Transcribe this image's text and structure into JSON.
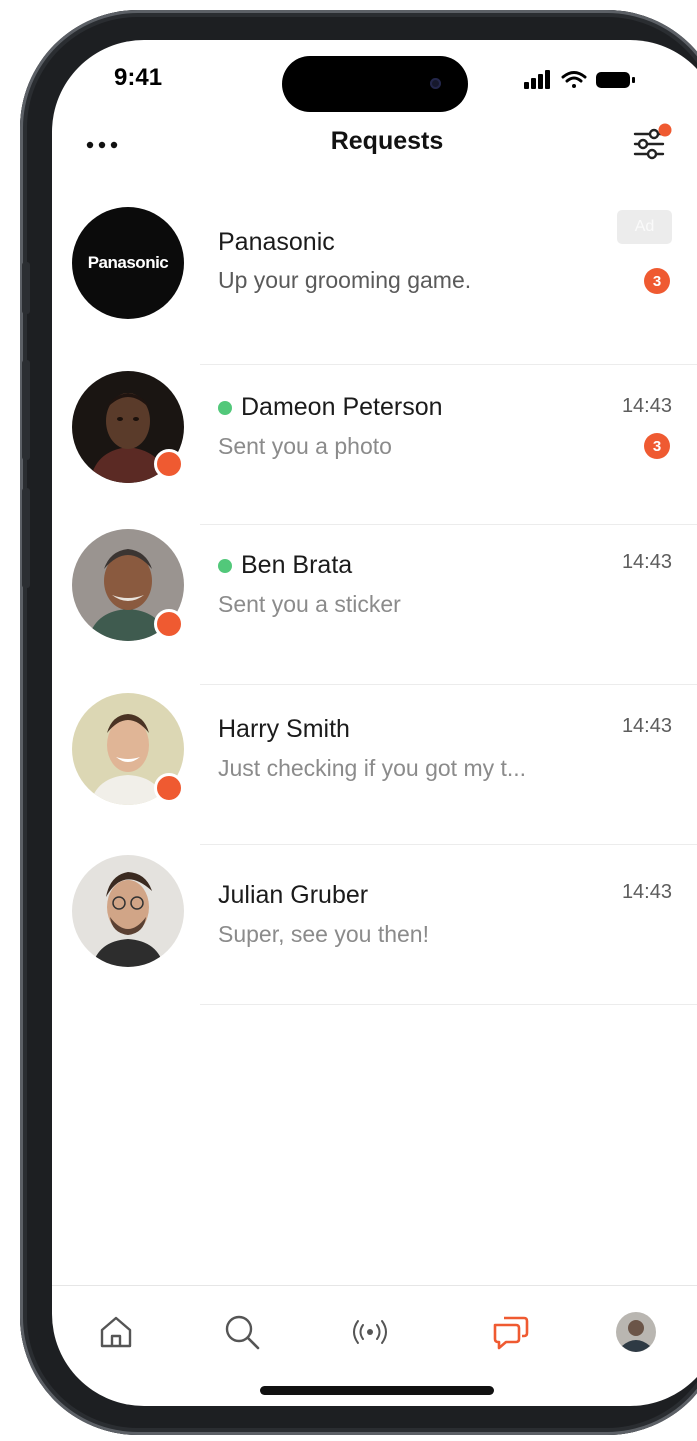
{
  "status_bar": {
    "time": "9:41"
  },
  "header": {
    "title": "Requests",
    "more_icon": "ellipsis-icon",
    "filter_icon": "sliders-icon"
  },
  "conversations": [
    {
      "name": "Panasonic",
      "preview": "Up your grooming game.",
      "ad_label": "Ad",
      "unread": "3",
      "logo_text": "Panasonic"
    },
    {
      "name": "Dameon Peterson",
      "preview": "Sent you a photo",
      "time": "14:43",
      "unread": "3",
      "online": true
    },
    {
      "name": "Ben Brata",
      "preview": "Sent you a sticker",
      "time": "14:43",
      "online": true
    },
    {
      "name": "Harry Smith",
      "preview": "Just checking if you got my t...",
      "time": "14:43"
    },
    {
      "name": "Julian Gruber",
      "preview": "Super, see you then!",
      "time": "14:43"
    }
  ],
  "tab_bar": {
    "items": [
      {
        "icon": "home-icon"
      },
      {
        "icon": "search-icon"
      },
      {
        "icon": "broadcast-icon"
      },
      {
        "icon": "chat-icon",
        "active": true
      },
      {
        "icon": "profile-avatar"
      }
    ]
  },
  "colors": {
    "accent": "#EF5A31",
    "online": "#52C87A",
    "text_primary": "#1B1B1B",
    "text_secondary": "#8B8B8B"
  }
}
